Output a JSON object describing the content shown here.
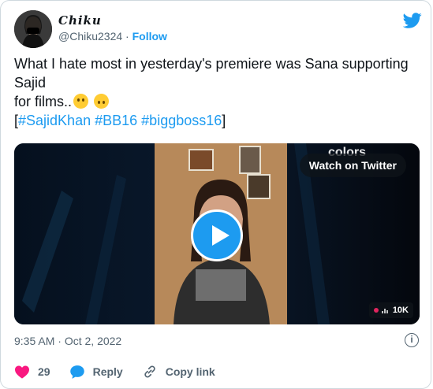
{
  "user": {
    "display_name": "Chiku",
    "handle": "@Chiku2324",
    "separator": "·",
    "follow_label": "Follow"
  },
  "tweet": {
    "line1": "What I hate most in yesterday's premiere was Sana supporting Sajid",
    "line2": "for films..",
    "open_bracket": "[",
    "hashtags": [
      "#SajidKhan",
      "#BB16",
      "#biggboss16"
    ],
    "close_bracket": "]"
  },
  "media": {
    "watch_label": "Watch on Twitter",
    "views": "10K"
  },
  "meta": {
    "time": "9:35 AM",
    "date": "Oct 2, 2022",
    "separator": "·"
  },
  "actions": {
    "like_count": "29",
    "reply_label": "Reply",
    "copy_link_label": "Copy link"
  },
  "colors": {
    "brand": "#1d9bf0",
    "like": "#f91880",
    "text": "#0f1419",
    "muted": "#536471"
  },
  "icons": [
    "twitter-bird-icon",
    "play-icon",
    "info-icon",
    "heart-icon",
    "reply-bubble-icon",
    "link-icon"
  ]
}
